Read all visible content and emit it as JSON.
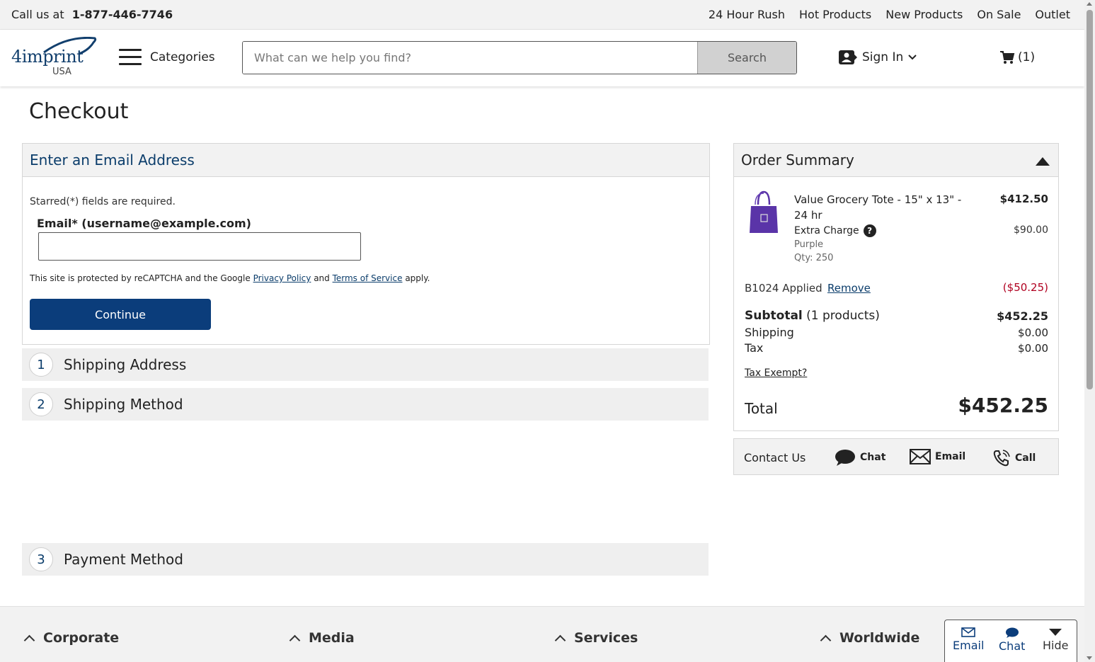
{
  "topbar": {
    "call_label": "Call us at",
    "phone": "1-877-446-7746",
    "links": [
      "24 Hour Rush",
      "Hot Products",
      "New Products",
      "On Sale",
      "Outlet"
    ]
  },
  "header": {
    "logo_word": "4imprint",
    "logo_region": "USA",
    "categories_label": "Categories",
    "search_placeholder": "What can we help you find?",
    "search_button": "Search",
    "signin_label": "Sign In",
    "cart_count": "(1)"
  },
  "page": {
    "title": "Checkout"
  },
  "email_panel": {
    "heading": "Enter an Email Address",
    "required_note": "Starred(*) fields are required.",
    "email_label": "Email* (username@example.com)",
    "email_value": "",
    "captcha_prefix": "This site is protected by reCAPTCHA and the Google",
    "privacy_link": "Privacy Policy",
    "captcha_and": "and",
    "terms_link": "Terms of Service",
    "captcha_suffix": "apply.",
    "continue_button": "Continue"
  },
  "steps": [
    {
      "number": "1",
      "label": "Shipping Address"
    },
    {
      "number": "2",
      "label": "Shipping Method"
    },
    {
      "number": "3",
      "label": "Payment Method"
    }
  ],
  "summary": {
    "heading": "Order Summary",
    "item": {
      "name": "Value Grocery Tote - 15\" x 13\" - 24 hr",
      "price": "$412.50",
      "extra_label": "Extra Charge",
      "extra_help": "?",
      "extra_price": "$90.00",
      "color": "Purple",
      "qty": "Qty: 250"
    },
    "promo_applied": "B1024 Applied",
    "remove_link": "Remove",
    "discount": "($50.25)",
    "subtotal_label": "Subtotal",
    "subtotal_count": "(1 products)",
    "subtotal_value": "$452.25",
    "shipping_label": "Shipping",
    "shipping_value": "$0.00",
    "tax_label": "Tax",
    "tax_value": "$0.00",
    "tax_exempt_link": "Tax Exempt?",
    "total_label": "Total",
    "total_value": "$452.25"
  },
  "contact": {
    "label": "Contact Us",
    "chat": "Chat",
    "email": "Email",
    "call": "Call"
  },
  "footer": {
    "sections": [
      "Corporate",
      "Media",
      "Services",
      "Worldwide"
    ]
  },
  "help_widget": {
    "email": "Email",
    "chat": "Chat",
    "hide": "Hide"
  },
  "colors": {
    "brand_navy": "#0b3d7b",
    "heading_blue": "#0b3d6b",
    "discount_red": "#b00020",
    "tote_purple": "#5a34a8"
  }
}
